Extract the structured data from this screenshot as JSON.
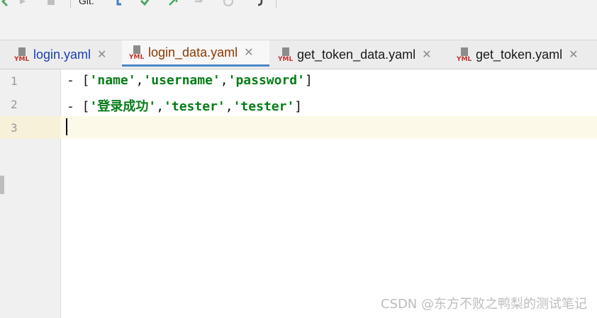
{
  "toolbar": {
    "git_label": "Git:"
  },
  "tabs": [
    {
      "label": "login.yaml",
      "active": false,
      "color": "#1a3fb5"
    },
    {
      "label": "login_data.yaml",
      "active": true,
      "color": "#8a3a00"
    },
    {
      "label": "get_token_data.yaml",
      "active": false,
      "color": "#1a1a1a"
    },
    {
      "label": "get_token.yaml",
      "active": false,
      "color": "#1a1a1a"
    }
  ],
  "editor": {
    "line_numbers": [
      "1",
      "2",
      "3"
    ],
    "lines": [
      {
        "dash": "- [",
        "s1": "'name'",
        "c1": ",",
        "s2": "'username'",
        "c2": ",",
        "s3": "'password'",
        "end": "]"
      },
      {
        "dash": "- [",
        "s1": "'登录成功'",
        "c1": ",",
        "s2": "'tester'",
        "c2": ",",
        "s3": "'tester'",
        "end": "]"
      }
    ]
  },
  "watermark": "CSDN @东方不败之鸭梨的测试笔记",
  "colors": {
    "string": "#067d17",
    "active_tab_underline": "#4a88c7",
    "caret_row": "#fdf9e8"
  }
}
